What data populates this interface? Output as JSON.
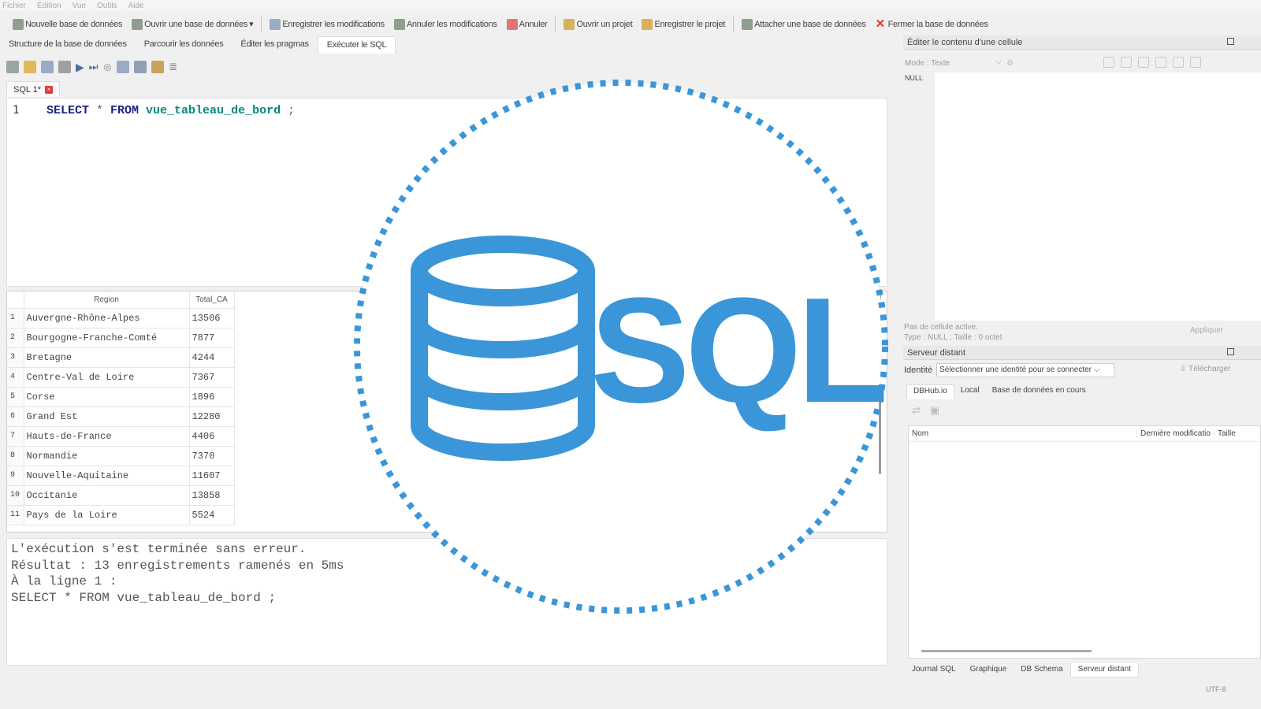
{
  "menu": [
    "Fichier",
    "Édition",
    "Vue",
    "Outils",
    "Aide"
  ],
  "toolbar": [
    {
      "label": "Nouvelle base de données",
      "icon": "new-db-icon",
      "color": "#7a8a7a"
    },
    {
      "label": "Ouvrir une base de données",
      "icon": "open-db-icon",
      "color": "#7a8a7a"
    },
    {
      "label": "Enregistrer les modifications",
      "icon": "save-icon",
      "color": "#8a9bb5"
    },
    {
      "label": "Annuler les modifications",
      "icon": "revert-icon",
      "color": "#7a8a7a"
    },
    {
      "label": "Annuler",
      "icon": "undo-icon",
      "color": "#e06666"
    },
    {
      "label": "Ouvrir un projet",
      "icon": "open-project-icon",
      "color": "#d4a84a"
    },
    {
      "label": "Enregistrer le projet",
      "icon": "save-project-icon",
      "color": "#d4a84a"
    },
    {
      "label": "Attacher une base de données",
      "icon": "attach-db-icon",
      "color": "#7a8a7a"
    },
    {
      "label": "Fermer la base de données",
      "icon": "close-db-icon",
      "color": "#e53935"
    }
  ],
  "tabs": [
    "Structure de la base de données",
    "Parcourir les données",
    "Éditer les pragmas",
    "Exécuter le SQL"
  ],
  "editor": {
    "tab_label": "SQL 1*",
    "line_number": "1",
    "kw_select": "SELECT",
    "star": " * ",
    "kw_from": "FROM",
    "view_name": " vue_tableau_de_bord",
    "end": " ;"
  },
  "results": {
    "columns": [
      "Region",
      "Total_CA"
    ],
    "rows": [
      [
        "1",
        "Auvergne-Rhône-Alpes",
        "13506"
      ],
      [
        "2",
        "Bourgogne-Franche-Comté",
        "7877"
      ],
      [
        "3",
        "Bretagne",
        "4244"
      ],
      [
        "4",
        "Centre-Val de Loire",
        "7367"
      ],
      [
        "5",
        "Corse",
        "1896"
      ],
      [
        "6",
        "Grand Est",
        "12280"
      ],
      [
        "7",
        "Hauts-de-France",
        "4406"
      ],
      [
        "8",
        "Normandie",
        "7370"
      ],
      [
        "9",
        "Nouvelle-Aquitaine",
        "11607"
      ],
      [
        "10",
        "Occitanie",
        "13858"
      ],
      [
        "11",
        "Pays de la Loire",
        "5524"
      ]
    ]
  },
  "messages": {
    "line1": "L'exécution s'est terminée sans erreur.",
    "line2": "Résultat : 13 enregistrements ramenés en 5ms",
    "line3": "À la ligne 1 :",
    "line4": "SELECT * FROM vue_tableau_de_bord ;"
  },
  "cell_panel": {
    "title": "Éditer le contenu d'une cellule",
    "mode": "Mode : Texte",
    "null_label": "NULL",
    "info1": "Pas de cellule active.",
    "info2": "Type : NULL ; Taille : 0 octet",
    "apply": "Appliquer"
  },
  "remote_panel": {
    "title": "Serveur distant",
    "identity_label": "Identité",
    "identity_select": "Sélectionner une identité pour se connecter",
    "download": "Télécharger",
    "tabs": [
      "DBHub.io",
      "Local",
      "Base de données en cours"
    ],
    "columns": [
      "Nom",
      "Dernière modificatio",
      "Taille"
    ]
  },
  "bottom_tabs": [
    "Journal SQL",
    "Graphique",
    "DB Schema",
    "Serveur distant"
  ],
  "encoding": "UTF-8",
  "overlay": {
    "text": "SQL",
    "color": "#3a96d8",
    "icon": "database-icon"
  }
}
